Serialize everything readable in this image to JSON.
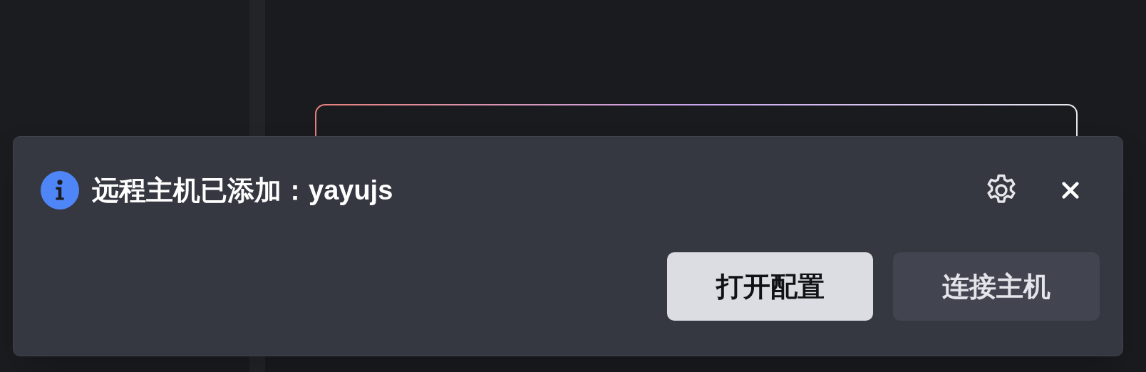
{
  "notification": {
    "kind": "info",
    "message": "远程主机已添加：yayujs",
    "actions": [
      {
        "label": "打开配置",
        "primary": true
      },
      {
        "label": "连接主机",
        "primary": false
      }
    ]
  }
}
